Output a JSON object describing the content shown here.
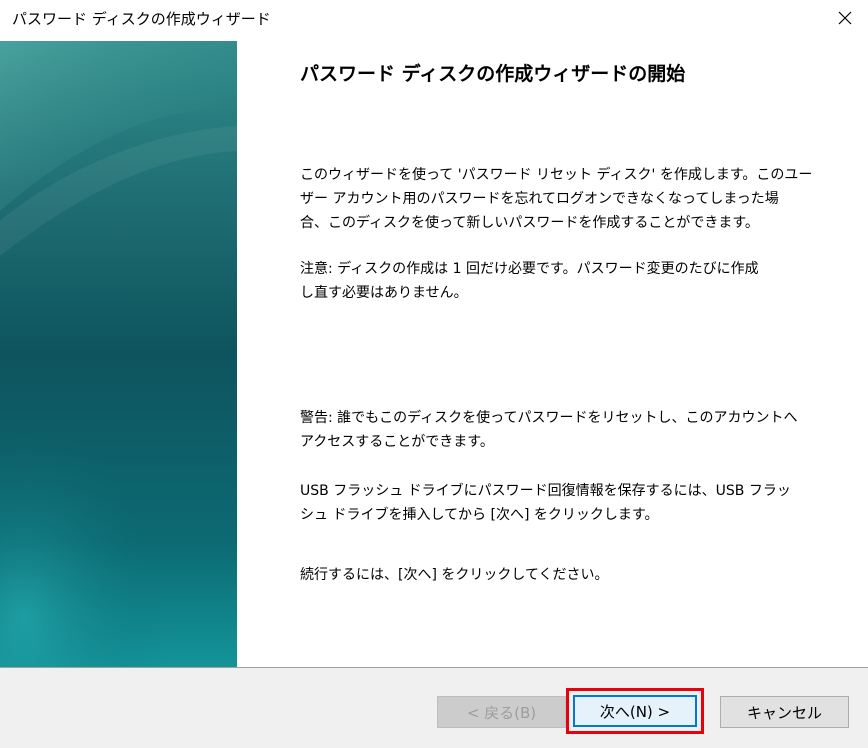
{
  "window": {
    "title": "パスワード ディスクの作成ウィザード",
    "close_label": "✕"
  },
  "content": {
    "heading": "パスワード ディスクの作成ウィザードの開始",
    "intro_lines": [
      "このウィザードを使って 'パスワード リセット ディスク' を作成します。このユー",
      "ザー アカウント用のパスワードを忘れてログオンできなくなってしまった場",
      "合、このディスクを使って新しいパスワードを作成することができます。"
    ],
    "note_lines": [
      "注意: ディスクの作成は 1 回だけ必要です。パスワード変更のたびに作成",
      "し直す必要はありません。"
    ],
    "warning_lines": [
      "警告: 誰でもこのディスクを使ってパスワードをリセットし、このアカウントへ",
      "アクセスすることができます。"
    ],
    "usb_lines": [
      "USB フラッシュ ドライブにパスワード回復情報を保存するには、USB フラッ",
      "シュ ドライブを挿入してから [次へ] をクリックします。"
    ],
    "continue_lines": [
      "続行するには、[次へ] をクリックしてください。"
    ]
  },
  "buttons": {
    "back_label": "< 戻る(B)",
    "next_label": "次へ(N) >",
    "cancel_label": "キャンセル"
  },
  "colors": {
    "highlight_border": "#e8000d",
    "focus_border": "#0078d7",
    "panel_teal": "#0f7f86"
  },
  "icons": {
    "close": "close-icon"
  }
}
